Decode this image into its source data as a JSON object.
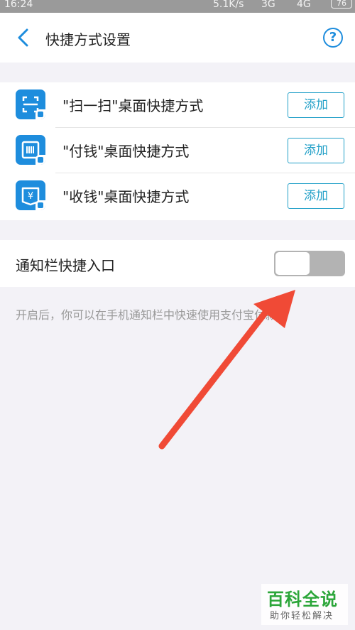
{
  "status_bar": {
    "time": "16:24",
    "network_speed": "5.1K/s",
    "signal_1": "3G",
    "signal_2": "4G",
    "battery": "76"
  },
  "header": {
    "title": "快捷方式设置",
    "back_icon": "chevron-left-icon",
    "help_icon": "question-circle-icon",
    "help_glyph": "?"
  },
  "shortcuts": {
    "items": [
      {
        "label": "\"扫一扫\"桌面快捷方式",
        "button": "添加",
        "icon": "scan-icon"
      },
      {
        "label": "\"付钱\"桌面快捷方式",
        "button": "添加",
        "icon": "pay-code-icon"
      },
      {
        "label": "\"收钱\"桌面快捷方式",
        "button": "添加",
        "icon": "receive-money-icon"
      }
    ]
  },
  "notification": {
    "label": "通知栏快捷入口",
    "enabled": false,
    "description": "开启后，你可以在手机通知栏中快速使用支付宝付款"
  },
  "colors": {
    "accent": "#1e8ddd",
    "button_border": "#22a0c8",
    "background": "#f3f2f7",
    "arrow": "#f04a36",
    "toggle_off": "#b3b3b3"
  },
  "watermark": {
    "brand": "百科全说",
    "slogan": "助你轻松解决"
  }
}
